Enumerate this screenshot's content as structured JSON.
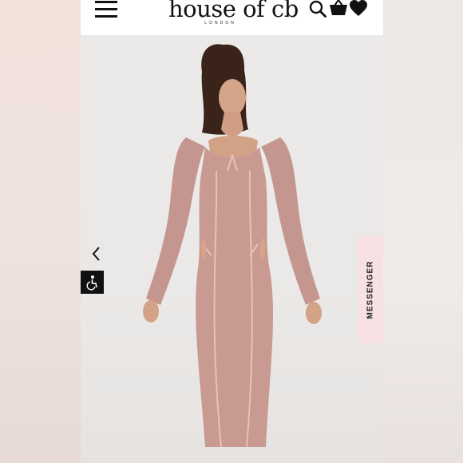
{
  "header": {
    "logo_text": "house of cb",
    "logo_subtext": "LONDON",
    "icons": [
      "menu-icon",
      "search-icon",
      "shopping-basket-icon",
      "heart-icon"
    ]
  },
  "gallery": {
    "prev_icon": "chevron-left-icon",
    "accessibility_icon": "accessibility-icon",
    "product_colors": {
      "dress": "#c99a91",
      "background": "#eceae8"
    }
  },
  "messenger": {
    "label": "MESSENGER"
  }
}
